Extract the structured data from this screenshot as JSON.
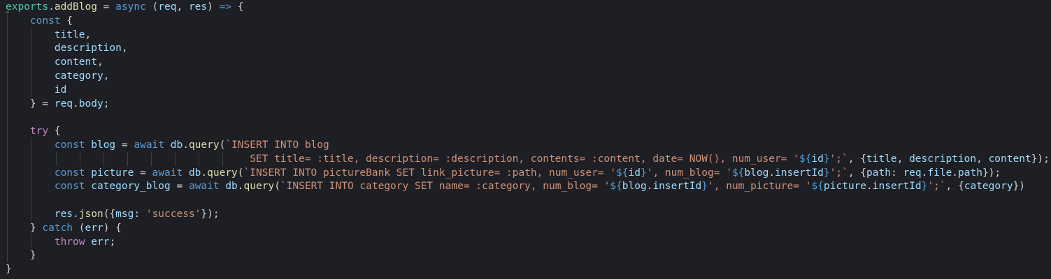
{
  "editor": {
    "language": "javascript",
    "theme_colors": {
      "background": "#1e1f24",
      "keyword": "#569cd6",
      "control_keyword": "#c586c0",
      "function": "#dcdcaa",
      "variable": "#9cdcfe",
      "string": "#ce9178",
      "text": "#d4d4d4"
    },
    "lines": [
      [
        [
          "grn",
          "exports"
        ],
        [
          "plain",
          "."
        ],
        [
          "fn",
          "addBlog"
        ],
        [
          "plain",
          " = "
        ],
        [
          "kw",
          "async"
        ],
        [
          "plain",
          " ("
        ],
        [
          "var",
          "req"
        ],
        [
          "plain",
          ", "
        ],
        [
          "var",
          "res"
        ],
        [
          "plain",
          ") "
        ],
        [
          "kw",
          "=>"
        ],
        [
          "plain",
          " {"
        ]
      ],
      [
        [
          "plain",
          "    "
        ],
        [
          "kw",
          "const"
        ],
        [
          "plain",
          " {"
        ]
      ],
      [
        [
          "plain",
          "        "
        ],
        [
          "var",
          "title"
        ],
        [
          "plain",
          ","
        ]
      ],
      [
        [
          "plain",
          "        "
        ],
        [
          "var",
          "description"
        ],
        [
          "plain",
          ","
        ]
      ],
      [
        [
          "plain",
          "        "
        ],
        [
          "var",
          "content"
        ],
        [
          "plain",
          ","
        ]
      ],
      [
        [
          "plain",
          "        "
        ],
        [
          "var",
          "category"
        ],
        [
          "plain",
          ","
        ]
      ],
      [
        [
          "plain",
          "        "
        ],
        [
          "var",
          "id"
        ]
      ],
      [
        [
          "plain",
          "    } = "
        ],
        [
          "var",
          "req"
        ],
        [
          "plain",
          "."
        ],
        [
          "var",
          "body"
        ],
        [
          "plain",
          ";"
        ]
      ],
      [],
      [
        [
          "plain",
          "    "
        ],
        [
          "kw2",
          "try"
        ],
        [
          "plain",
          " {"
        ]
      ],
      [
        [
          "plain",
          "        "
        ],
        [
          "kw",
          "const"
        ],
        [
          "plain",
          " "
        ],
        [
          "var",
          "blog"
        ],
        [
          "plain",
          " = "
        ],
        [
          "kw",
          "await"
        ],
        [
          "plain",
          " "
        ],
        [
          "var",
          "db"
        ],
        [
          "plain",
          "."
        ],
        [
          "fn",
          "query"
        ],
        [
          "plain",
          "("
        ],
        [
          "str",
          "`INSERT INTO blog"
        ]
      ],
      [
        [
          "str",
          "                                        SET title= :title, description= :description, contents= :content, date= NOW(), num_user= '"
        ],
        [
          "kw",
          "${"
        ],
        [
          "var",
          "id"
        ],
        [
          "kw",
          "}"
        ],
        [
          "str",
          "';`"
        ],
        [
          "plain",
          ", {"
        ],
        [
          "var",
          "title"
        ],
        [
          "plain",
          ", "
        ],
        [
          "var",
          "description"
        ],
        [
          "plain",
          ", "
        ],
        [
          "var",
          "content"
        ],
        [
          "plain",
          "});"
        ]
      ],
      [
        [
          "plain",
          "        "
        ],
        [
          "kw",
          "const"
        ],
        [
          "plain",
          " "
        ],
        [
          "var",
          "picture"
        ],
        [
          "plain",
          " = "
        ],
        [
          "kw",
          "await"
        ],
        [
          "plain",
          " "
        ],
        [
          "var",
          "db"
        ],
        [
          "plain",
          "."
        ],
        [
          "fn",
          "query"
        ],
        [
          "plain",
          "("
        ],
        [
          "str",
          "`INSERT INTO pictureBank SET link_picture= :path, num_user= '"
        ],
        [
          "kw",
          "${"
        ],
        [
          "var",
          "id"
        ],
        [
          "kw",
          "}"
        ],
        [
          "str",
          "', num_blog= '"
        ],
        [
          "kw",
          "${"
        ],
        [
          "var",
          "blog"
        ],
        [
          "plain",
          "."
        ],
        [
          "var",
          "insertId"
        ],
        [
          "kw",
          "}"
        ],
        [
          "str",
          "';`"
        ],
        [
          "plain",
          ", {"
        ],
        [
          "var",
          "path"
        ],
        [
          "plain",
          ": "
        ],
        [
          "var",
          "req"
        ],
        [
          "plain",
          "."
        ],
        [
          "var",
          "file"
        ],
        [
          "plain",
          "."
        ],
        [
          "var",
          "path"
        ],
        [
          "plain",
          "});"
        ]
      ],
      [
        [
          "plain",
          "        "
        ],
        [
          "kw",
          "const"
        ],
        [
          "plain",
          " "
        ],
        [
          "var",
          "category_blog"
        ],
        [
          "plain",
          " = "
        ],
        [
          "kw",
          "await"
        ],
        [
          "plain",
          " "
        ],
        [
          "var",
          "db"
        ],
        [
          "plain",
          "."
        ],
        [
          "fn",
          "query"
        ],
        [
          "plain",
          "("
        ],
        [
          "str",
          "`INSERT INTO category SET name= :category, num_blog= '"
        ],
        [
          "kw",
          "${"
        ],
        [
          "var",
          "blog"
        ],
        [
          "plain",
          "."
        ],
        [
          "var",
          "insertId"
        ],
        [
          "kw",
          "}"
        ],
        [
          "str",
          "', num_picture= '"
        ],
        [
          "kw",
          "${"
        ],
        [
          "var",
          "picture"
        ],
        [
          "plain",
          "."
        ],
        [
          "var",
          "insertId"
        ],
        [
          "kw",
          "}"
        ],
        [
          "str",
          "';`"
        ],
        [
          "plain",
          ", {"
        ],
        [
          "var",
          "category"
        ],
        [
          "plain",
          "})"
        ]
      ],
      [],
      [
        [
          "plain",
          "        "
        ],
        [
          "var",
          "res"
        ],
        [
          "plain",
          "."
        ],
        [
          "fn",
          "json"
        ],
        [
          "plain",
          "({"
        ],
        [
          "var",
          "msg"
        ],
        [
          "plain",
          ": "
        ],
        [
          "str",
          "'success'"
        ],
        [
          "plain",
          "});"
        ]
      ],
      [
        [
          "plain",
          "    } "
        ],
        [
          "kw",
          "catch"
        ],
        [
          "plain",
          " ("
        ],
        [
          "var",
          "err"
        ],
        [
          "plain",
          ") {"
        ]
      ],
      [
        [
          "plain",
          "        "
        ],
        [
          "kw2",
          "throw"
        ],
        [
          "plain",
          " "
        ],
        [
          "var",
          "err"
        ],
        [
          "plain",
          ";"
        ]
      ],
      [
        [
          "plain",
          "    }"
        ]
      ],
      [
        [
          "plain",
          "}"
        ]
      ]
    ]
  }
}
